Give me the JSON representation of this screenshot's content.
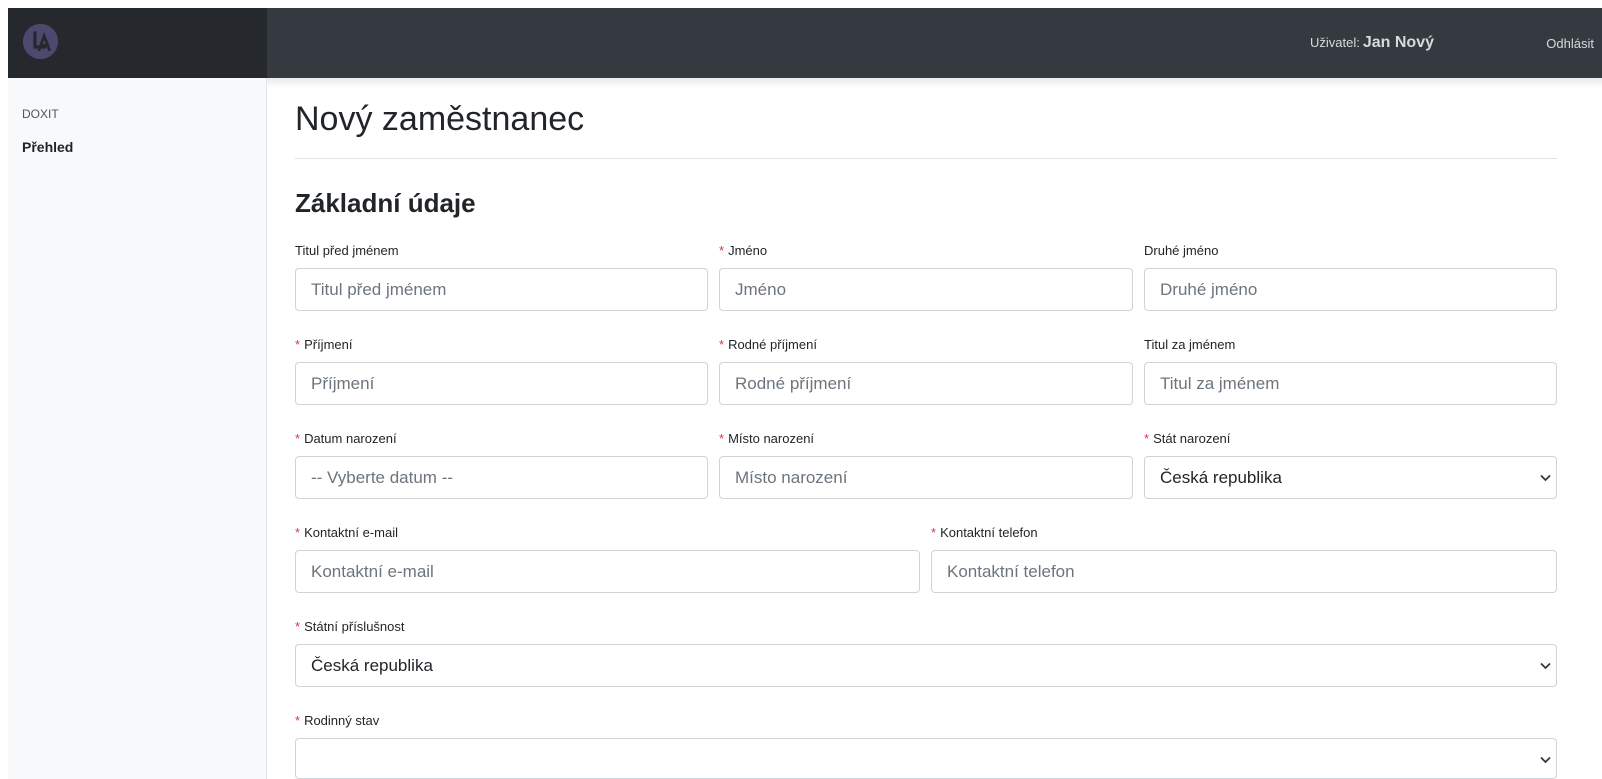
{
  "header": {
    "user_label": "Uživatel:",
    "user_name": "Jan Nový",
    "logout_label": "Odhlásit"
  },
  "sidebar": {
    "section_title": "DOXIT",
    "items": [
      {
        "label": "Přehled"
      }
    ]
  },
  "page": {
    "title": "Nový zaměstnanec",
    "section_title": "Základní údaje"
  },
  "form": {
    "required_mark": "*",
    "titul_pred": {
      "label": "Titul před jménem",
      "placeholder": "Titul před jménem"
    },
    "jmeno": {
      "label": "Jméno",
      "placeholder": "Jméno"
    },
    "druhe_jmeno": {
      "label": "Druhé jméno",
      "placeholder": "Druhé jméno"
    },
    "prijmeni": {
      "label": "Příjmení",
      "placeholder": "Příjmení"
    },
    "rodne_prijmeni": {
      "label": "Rodné příjmení",
      "placeholder": "Rodné příjmení"
    },
    "titul_za": {
      "label": "Titul za jménem",
      "placeholder": "Titul za jménem"
    },
    "datum_narozeni": {
      "label": "Datum narození",
      "placeholder": "-- Vyberte datum --"
    },
    "misto_narozeni": {
      "label": "Místo narození",
      "placeholder": "Místo narození"
    },
    "stat_narozeni": {
      "label": "Stát narození",
      "value": "Česká republika"
    },
    "email": {
      "label": "Kontaktní e-mail",
      "placeholder": "Kontaktní e-mail"
    },
    "telefon": {
      "label": "Kontaktní telefon",
      "placeholder": "Kontaktní telefon"
    },
    "statni_prislusnost": {
      "label": "Státní příslušnost",
      "value": "Česká republika"
    },
    "rodinny_stav": {
      "label": "Rodinný stav",
      "value": ""
    }
  },
  "colors": {
    "topbar": "#343a40",
    "sidebar_header": "#25282c",
    "required": "#dc3545"
  }
}
